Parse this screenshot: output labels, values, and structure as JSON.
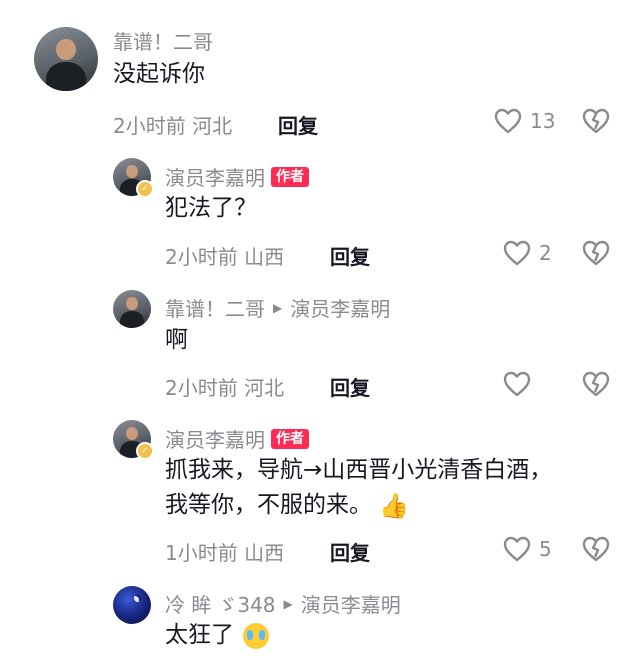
{
  "comments": [
    {
      "author": "靠谱！二哥",
      "text": "没起诉你",
      "time": "2小时前",
      "location": "河北",
      "reply_label": "回复",
      "likes": "13"
    },
    {
      "author": "演员李嘉明",
      "author_badge": "作者",
      "text": "犯法了？",
      "time": "2小时前",
      "location": "山西",
      "reply_label": "回复",
      "likes": "2"
    },
    {
      "author": "靠谱！二哥",
      "reply_to": "演员李嘉明",
      "text": "啊",
      "time": "2小时前",
      "location": "河北",
      "reply_label": "回复",
      "likes": ""
    },
    {
      "author": "演员李嘉明",
      "author_badge": "作者",
      "text_line1": "抓我来，导航→山西晋小光清香白酒，",
      "text_line2": "我等你，不服的来。",
      "time": "1小时前",
      "location": "山西",
      "reply_label": "回复",
      "likes": "5"
    },
    {
      "author": "冷 眸",
      "author_suffix": "ゞ348",
      "reply_to": "演员李嘉明",
      "text": "太狂了"
    }
  ],
  "icons": {
    "like": "heart-outline-icon",
    "dislike": "broken-heart-icon",
    "reply_arrow": "triangle-right-icon",
    "verified": "verified-badge-icon"
  },
  "colors": {
    "badge": "#fe2c55",
    "meta": "#8a8b91",
    "text": "#161823"
  }
}
